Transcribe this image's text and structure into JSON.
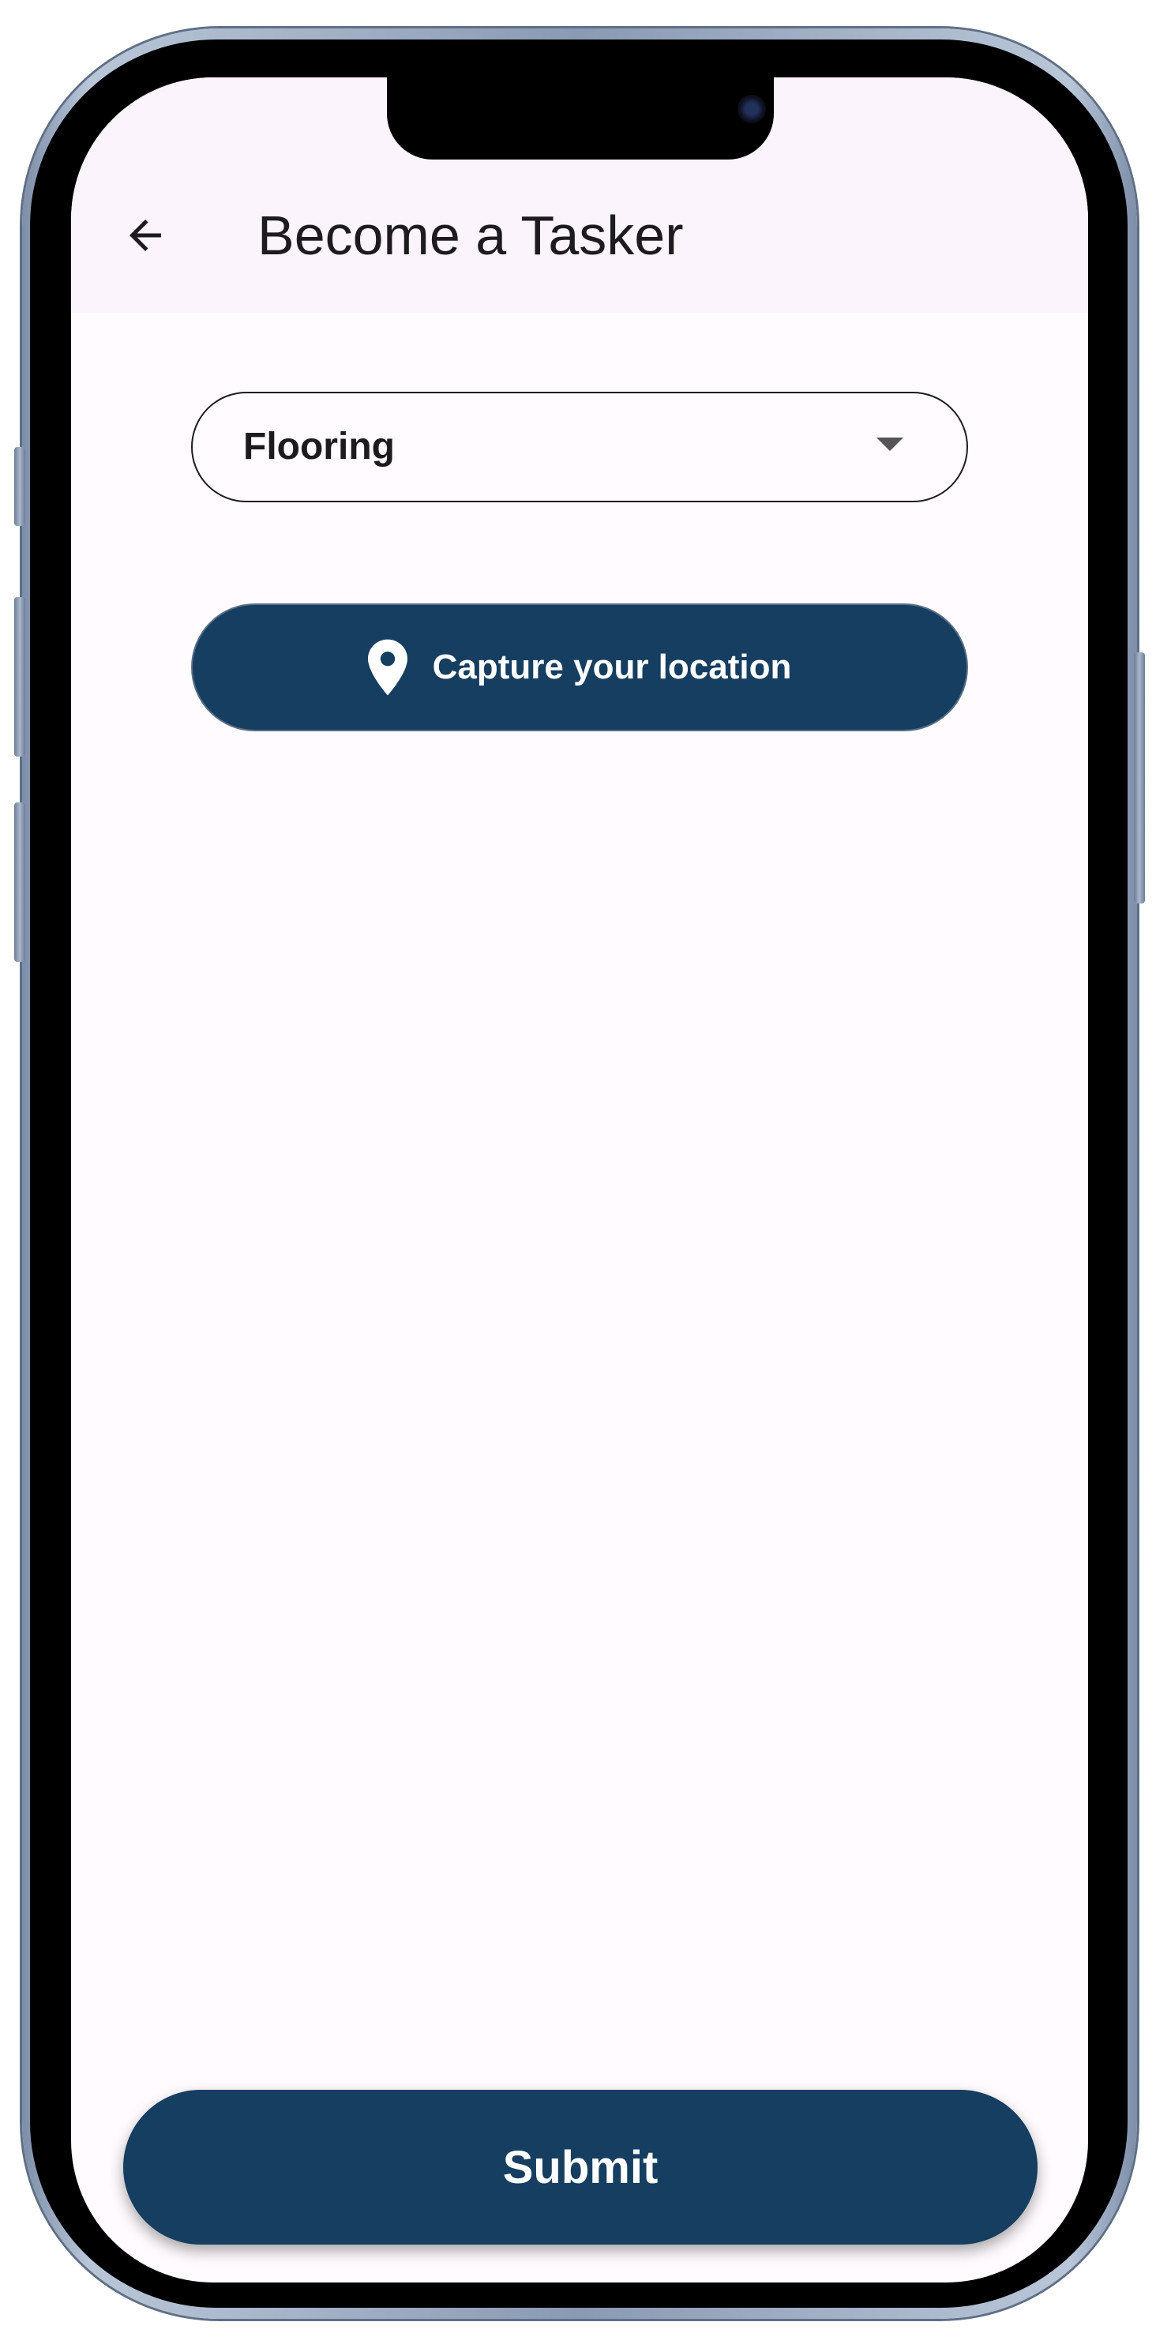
{
  "app_bar": {
    "title": "Become a Tasker",
    "back_icon": "arrow-back-icon"
  },
  "form": {
    "category_dropdown": {
      "selected": "Flooring",
      "icon": "dropdown-triangle-icon"
    },
    "location_button": {
      "label": "Capture your location",
      "icon": "location-pin-icon"
    },
    "submit_button": {
      "label": "Submit"
    }
  },
  "colors": {
    "primary": "#163e60",
    "app_bar_bg": "#fcf4fc",
    "screen_bg": "#fffbfe",
    "text": "#1d1b20"
  }
}
